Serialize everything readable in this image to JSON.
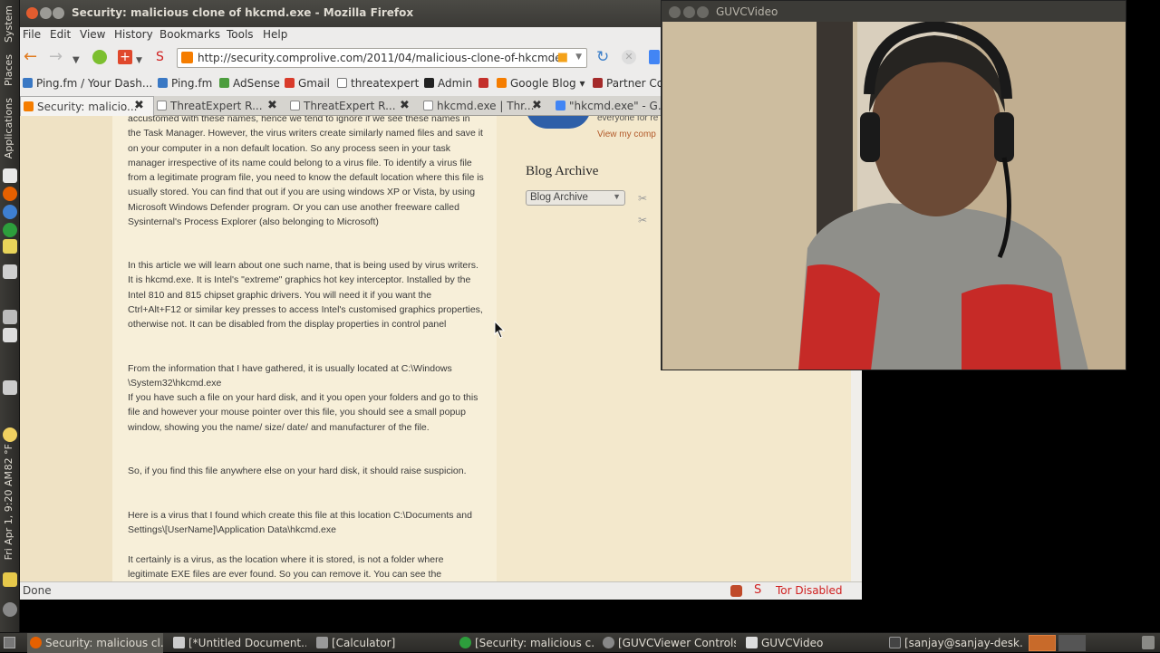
{
  "left_panel": {
    "system": "System",
    "places": "Places",
    "applications": "Applications",
    "weather": "82 °F",
    "clock": "Fri Apr 1, 9:20 AM"
  },
  "firefox": {
    "title": "Security: malicious clone of hkcmd.exe - Mozilla Firefox",
    "menu": [
      "File",
      "Edit",
      "View",
      "History",
      "Bookmarks",
      "Tools",
      "Help"
    ],
    "url": "http://security.comprolive.com/2011/04/malicious-clone-of-hkcmde",
    "bookmarks": [
      "Ping.fm / Your Dash...",
      "Ping.fm",
      "AdSense",
      "Gmail",
      "threatexpert",
      "Admin",
      "Google Blog",
      "Partner Co"
    ],
    "tabs": [
      "Security: malicio...",
      "ThreatExpert R...",
      "ThreatExpert R...",
      "hkcmd.exe | Thr...",
      "\"hkcmd.exe\" - G..."
    ],
    "article": [
      "accustomed with these names, hence we tend to ignore if we see these names in the Task Manager. However, the virus writers create similarly named files and save it on your computer in a non default location. So any process seen in your task manager irrespective of its name could belong to a virus file. To identify a virus file from a legitimate program file, you need to know the default location where this file is usually stored. You can find that out if you are using windows XP or Vista, by using Microsoft Windows Defender program. Or you can use another freeware called Sysinternal's Process Explorer (also belonging to Microsoft)",
      "In this article we will learn about one such name, that is being used by virus writers. It is hkcmd.exe. It is Intel's \"extreme\" graphics hot key interceptor. Installed by the Intel 810 and 815 chipset graphic drivers. You will need it if you want the Ctrl+Alt+F12 or similar key presses to access Intel's customised graphics properties, otherwise not. It can be disabled from the display properties in control panel",
      "From the information that I have gathered, it is usually located at C:\\Windows \\System32\\hkcmd.exe",
      "If you have such a file on your hard disk, and it you open your folders and go to this file and however your mouse pointer over this file, you should see a small popup window, showing you the name/ size/ date/ and manufacturer of the file.",
      "So, if you find this file anywhere else on your hard disk, it should raise suspicion.",
      "Here is a virus that I found which create this file at this location C:\\Documents and Settings\\[UserName]\\Application Data\\hkcmd.exe",
      "It certainly is a virus, as the location where it is stored, is not a folder where legitimate EXE files are ever found. So you can remove it. You can see the"
    ],
    "sidebar": {
      "snippet": "everyone for re",
      "view_link": "View my comp",
      "blog_archive_heading": "Blog Archive",
      "blog_archive_select": "Blog Archive"
    },
    "status": "Done",
    "tor": "Tor Disabled"
  },
  "guvc": {
    "title": "GUVCVideo"
  },
  "taskbar": [
    "Security: malicious cl...",
    "[*Untitled Document...",
    "[Calculator]",
    "[Security: malicious c...",
    "[GUVCViewer Controls]",
    "GUVCVideo",
    "[sanjay@sanjay-desk..."
  ]
}
